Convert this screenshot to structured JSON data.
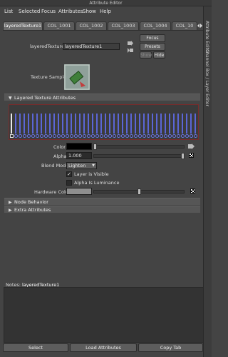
{
  "window": {
    "title": "Attribute Editor"
  },
  "menu": {
    "items": [
      "List",
      "Selected",
      "Focus",
      "Attributes",
      "Show",
      "Help"
    ]
  },
  "tabs": [
    "layeredTexture1",
    "COL_1001",
    "COL_1002",
    "COL_1003",
    "COL_1004",
    "COL_10"
  ],
  "right_strip": {
    "top_label": "Attribute Editor",
    "bottom_label": "Channel Box / Layer Editor"
  },
  "node": {
    "label": "layeredTexture:",
    "value": "layeredTexture1"
  },
  "side_buttons": {
    "focus": "Focus",
    "presets": "Presets",
    "show": "Show",
    "hide": "Hide"
  },
  "texture_sample": {
    "label": "Texture Sample"
  },
  "sections": {
    "layered": "Layered Texture Attributes",
    "node_behavior": "Node Behavior",
    "extra": "Extra Attributes"
  },
  "attrs": {
    "color_label": "Color",
    "alpha_label": "Alpha",
    "alpha_value": "1.000",
    "blend_label": "Blend Mode",
    "blend_value": "Lighten",
    "layer_visible": "Layer is Visible",
    "alpha_lum": "Alpha Is Luminance",
    "hw_label": "Hardware Color"
  },
  "notes": {
    "label": "Notes:",
    "node": "layeredTexture1"
  },
  "bottom_buttons": {
    "select": "Select",
    "load": "Load Attributes",
    "copy": "Copy Tab"
  },
  "colors": {
    "accent": "#5b66d6",
    "panel": "#444444",
    "frame": "#7a2a2a"
  }
}
